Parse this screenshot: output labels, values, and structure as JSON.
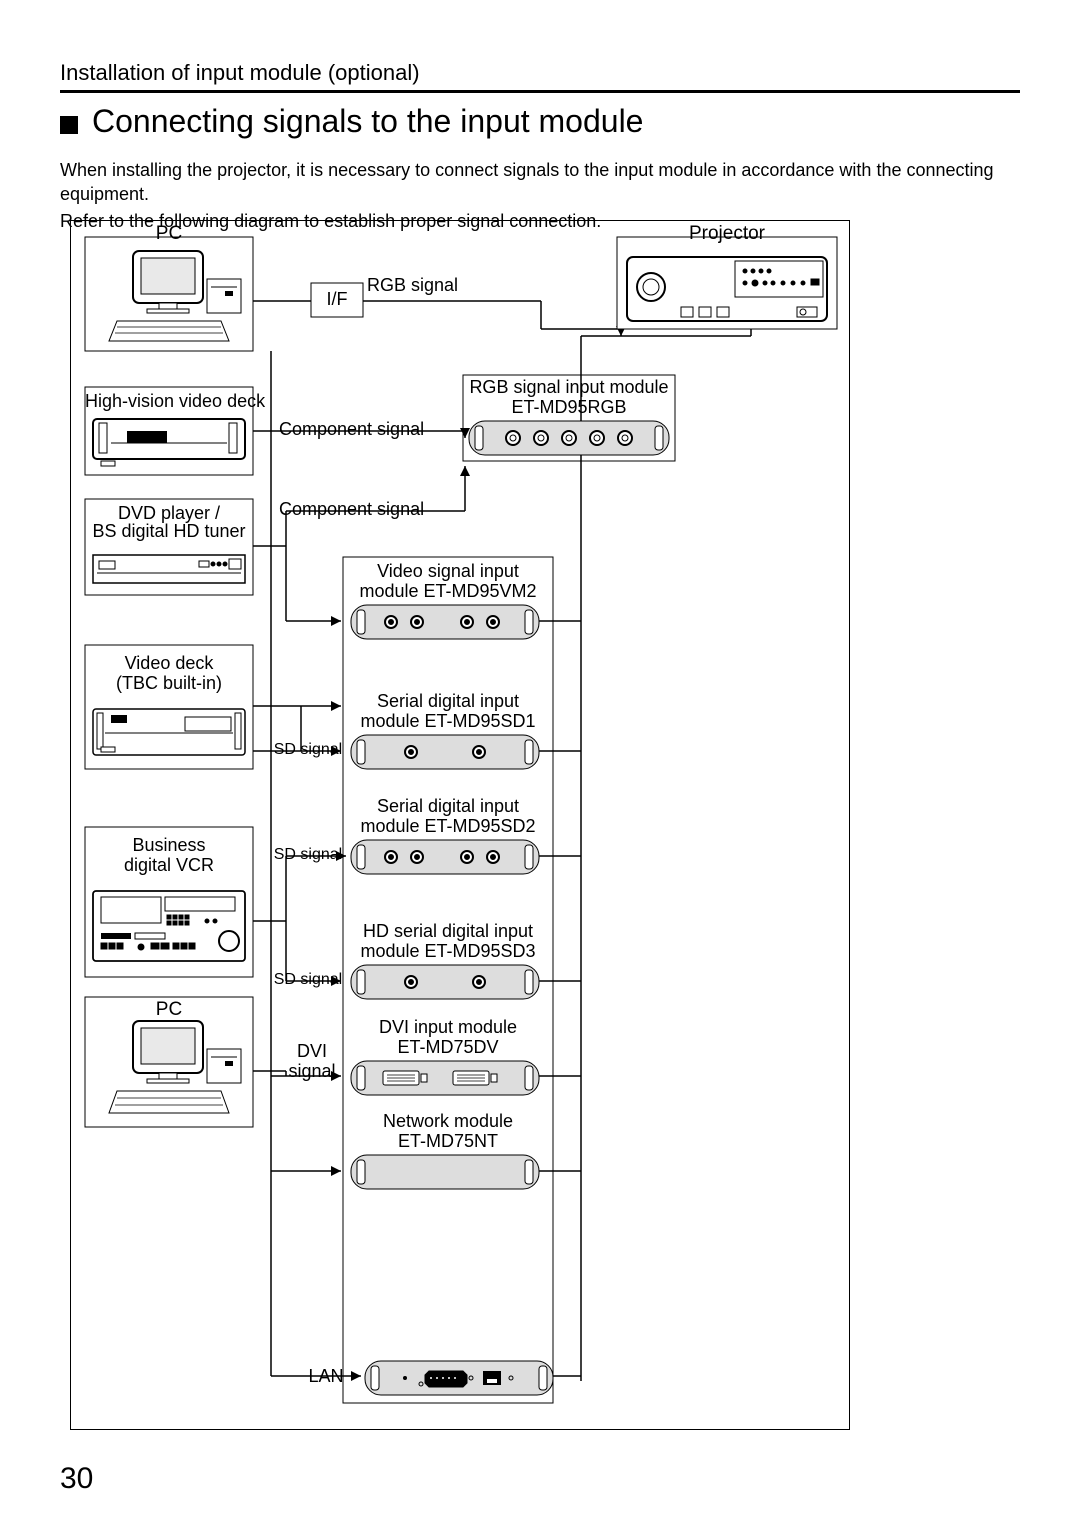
{
  "breadcrumb": "Installation of input module (optional)",
  "title": "Connecting signals to the input module",
  "para1": "When installing the projector, it is necessary to connect signals to the input module in accordance with the connecting equipment.",
  "para2": "Refer to the following diagram to establish proper signal connection.",
  "page_number": "30",
  "labels": {
    "pc1": "PC",
    "projector": "Projector",
    "if": "I/F",
    "rgb_signal": "RGB signal",
    "rgb_module_l1": "RGB signal input module",
    "rgb_module_l2": "ET-MD95RGB",
    "hv_deck": "High-vision video deck",
    "component_signal": "Component signal",
    "dvd_l1": "DVD player /",
    "dvd_l2": "BS digital HD tuner",
    "component_signal2": "Component signal",
    "video_input_l1": "Video signal input",
    "video_input_l2": "module ET-MD95VM2",
    "video_deck_l1": "Video deck",
    "video_deck_l2": "(TBC built-in)",
    "sd1_l1": "Serial digital input",
    "sd1_l2": "module ET-MD95SD1",
    "sd_signal": "SD signal",
    "sd2_l1": "Serial digital input",
    "sd2_l2": "module ET-MD95SD2",
    "biz_l1": "Business",
    "biz_l2": "digital VCR",
    "sd_signal2": "SD signal",
    "hd_l1": "HD serial digital input",
    "hd_l2": "module ET-MD95SD3",
    "sd_signal3": "SD signal",
    "pc2": "PC",
    "dvi_l1": "DVI input module",
    "dvi_l2": "ET-MD75DV",
    "dvi_signal_l1": "DVI",
    "dvi_signal_l2": "signal",
    "net_l1": "Network module",
    "net_l2": "ET-MD75NT",
    "lan": "LAN"
  }
}
